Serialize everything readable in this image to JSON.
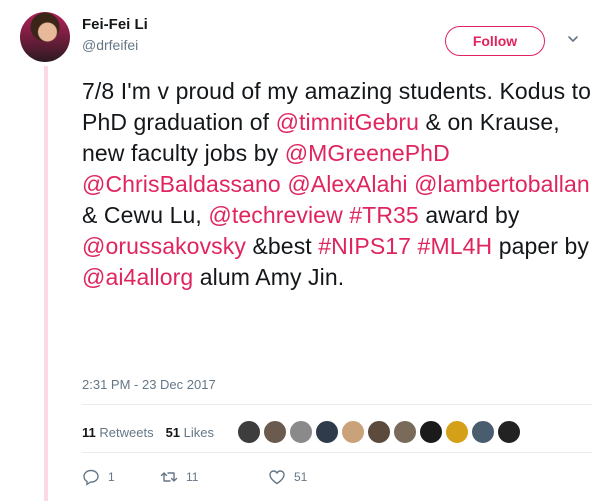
{
  "user": {
    "display_name": "Fei-Fei Li",
    "handle": "@drfeifei"
  },
  "follow_label": "Follow",
  "tweet": {
    "segments": [
      {
        "text": "7/8 I'm v proud of my amazing students. Kodus to PhD graduation of ",
        "link": false
      },
      {
        "text": "@timnitGebru",
        "link": true
      },
      {
        "text": " & on Krause, new faculty jobs by ",
        "link": false
      },
      {
        "text": "@MGreenePhD",
        "link": true
      },
      {
        "text": " ",
        "link": false
      },
      {
        "text": "@ChrisBaldassano",
        "link": true
      },
      {
        "text": " ",
        "link": false
      },
      {
        "text": "@AlexAlahi",
        "link": true
      },
      {
        "text": " ",
        "link": false
      },
      {
        "text": "@lambertoballan",
        "link": true
      },
      {
        "text": " & Cewu Lu, ",
        "link": false
      },
      {
        "text": "@techreview",
        "link": true
      },
      {
        "text": " ",
        "link": false
      },
      {
        "text": "#TR35",
        "link": true
      },
      {
        "text": " award by ",
        "link": false
      },
      {
        "text": "@orussakovsky",
        "link": true
      },
      {
        "text": " &best ",
        "link": false
      },
      {
        "text": "#NIPS17",
        "link": true
      },
      {
        "text": " ",
        "link": false
      },
      {
        "text": "#ML4H",
        "link": true
      },
      {
        "text": " paper by ",
        "link": false
      },
      {
        "text": "@ai4allorg",
        "link": true
      },
      {
        "text": " alum Amy Jin.",
        "link": false
      }
    ],
    "timestamp": "2:31 PM - 23 Dec 2017"
  },
  "stats": {
    "retweets_count": "11",
    "retweets_label": "Retweets",
    "likes_count": "51",
    "likes_label": "Likes"
  },
  "likers": [
    "#3d3d3d",
    "#6b5a4e",
    "#8a8a8a",
    "#2f3b4a",
    "#c9a27a",
    "#5c4a3c",
    "#7a6a5a",
    "#1a1a1a",
    "#d4a017",
    "#4a5d6e",
    "#222222"
  ],
  "actions": {
    "reply_count": "1",
    "retweet_count": "11",
    "like_count": "51"
  },
  "colors": {
    "accent": "#e0245e",
    "thread": "#fadbe5",
    "muted": "#657786"
  }
}
